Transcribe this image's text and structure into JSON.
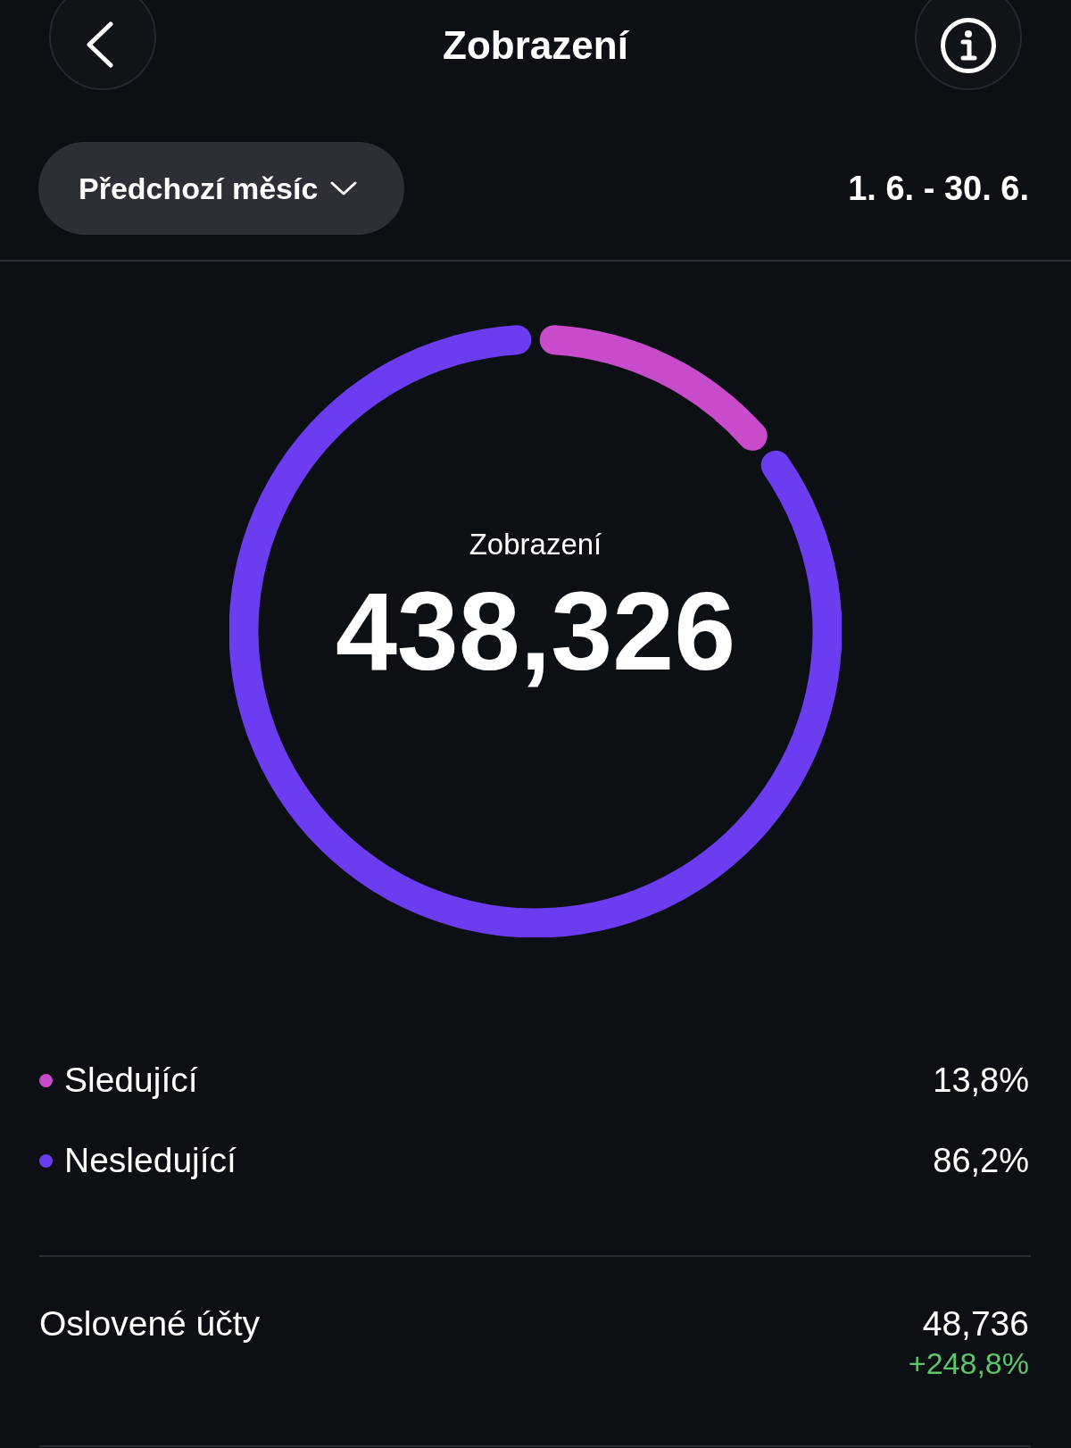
{
  "header": {
    "title": "Zobrazení"
  },
  "period": {
    "selected_label": "Předchozí měsíc",
    "date_range": "1. 6. - 30. 6."
  },
  "summary": {
    "label": "Zobrazení",
    "value": "438,326",
    "chart_data": {
      "type": "donut",
      "categories": [
        "Sledující",
        "Nesledující"
      ],
      "values": [
        13.8,
        86.2
      ]
    }
  },
  "legend": [
    {
      "value": "13,8%",
      "color": "#c84bcb"
    },
    {
      "value": "86,2%",
      "color": "#6c3cf0"
    }
  ],
  "metrics": [
    {
      "label": "Oslovené účty",
      "value": "48,736",
      "change": "+248,8%"
    }
  ]
}
